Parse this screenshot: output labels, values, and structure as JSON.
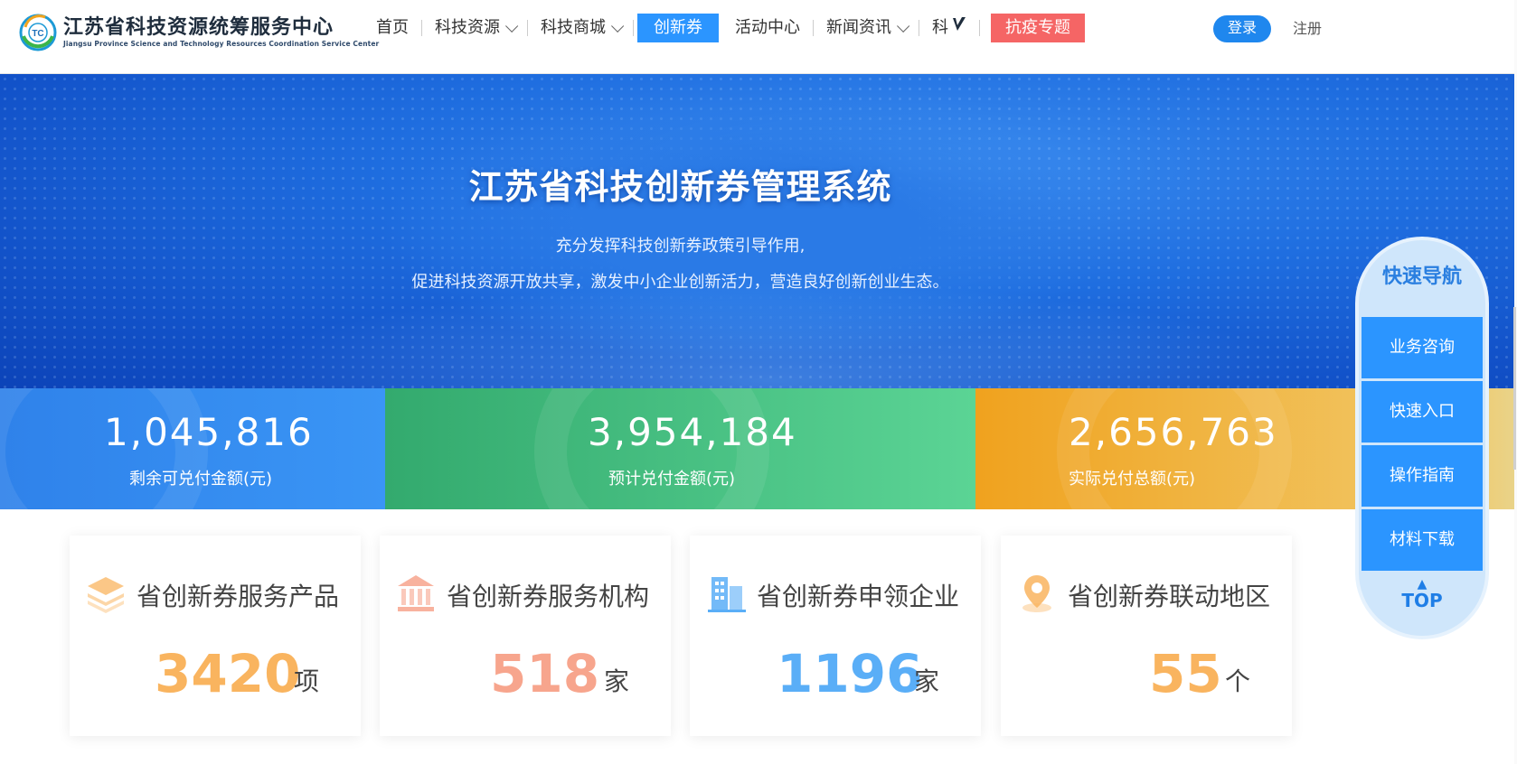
{
  "header": {
    "logo_badge": "TC",
    "logo_title": "江苏省科技资源统筹服务中心",
    "logo_subtitle": "Jiangsu Province Science and Technology Resources Coordination Service Center",
    "nav": [
      {
        "label": "首页"
      },
      {
        "label": "科技资源"
      },
      {
        "label": "科技商城"
      },
      {
        "label": "创新券"
      },
      {
        "label": "活动中心"
      },
      {
        "label": "新闻资讯"
      },
      {
        "label": "科"
      },
      {
        "label": "抗疫专题"
      }
    ],
    "login_label": "登录",
    "register_label": "注册"
  },
  "hero": {
    "title": "江苏省科技创新券管理系统",
    "subtitle_line1": "充分发挥科技创新券政策引导作用,",
    "subtitle_line2": "促进科技资源开放共享，激发中小企业创新活力，营造良好创新创业生态。"
  },
  "stats": [
    {
      "value": "1,045,816",
      "label": "剩余可兑付金额(元)"
    },
    {
      "value": "3,954,184",
      "label": "预计兑付金额(元)"
    },
    {
      "value": "2,656,763",
      "label": "实际兑付总额(元)"
    }
  ],
  "cards": [
    {
      "title": "省创新券服务产品",
      "value": "3420",
      "unit": "项",
      "color": "#f9b45f"
    },
    {
      "title": "省创新券服务机构",
      "value": "518",
      "unit": "家",
      "color": "#f7a58d"
    },
    {
      "title": "省创新券申领企业",
      "value": "1196",
      "unit": "家",
      "color": "#5aaef7"
    },
    {
      "title": "省创新券联动地区",
      "value": "55",
      "unit": "个",
      "color": "#f9b45f"
    }
  ],
  "quick_nav": {
    "title": "快速导航",
    "items": [
      {
        "label": "业务咨询"
      },
      {
        "label": "快速入口"
      },
      {
        "label": "操作指南"
      },
      {
        "label": "材料下载"
      }
    ],
    "top_label": "TOP"
  },
  "colors": {
    "accent": "#2b95ff",
    "login_btn": "#1f87ee",
    "epidemic_btn": "#f56565"
  }
}
